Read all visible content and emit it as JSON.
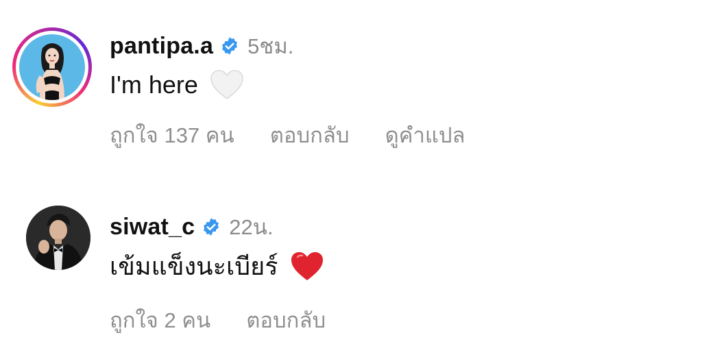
{
  "comments": [
    {
      "username": "pantipa.a",
      "time": "5ชม.",
      "text": "I'm here",
      "emoji": "white-heart-icon",
      "likes": "ถูกใจ 137 คน",
      "reply": "ตอบกลับ",
      "translate": "ดูคำแปล"
    },
    {
      "username": "siwat_c",
      "time": "22น.",
      "text": "เข้มแข็งนะเบียร์",
      "emoji": "red-heart-icon",
      "likes": "ถูกใจ 2 คน",
      "reply": "ตอบกลับ"
    }
  ],
  "colors": {
    "verified_badge": "#3897f0",
    "secondary_text": "#8e8e8e",
    "primary_text": "#111111",
    "story_ring_start": "#f9ce34",
    "story_ring_mid": "#ee2a7b",
    "story_ring_end": "#6228d7",
    "red_heart": "#e0242f"
  }
}
